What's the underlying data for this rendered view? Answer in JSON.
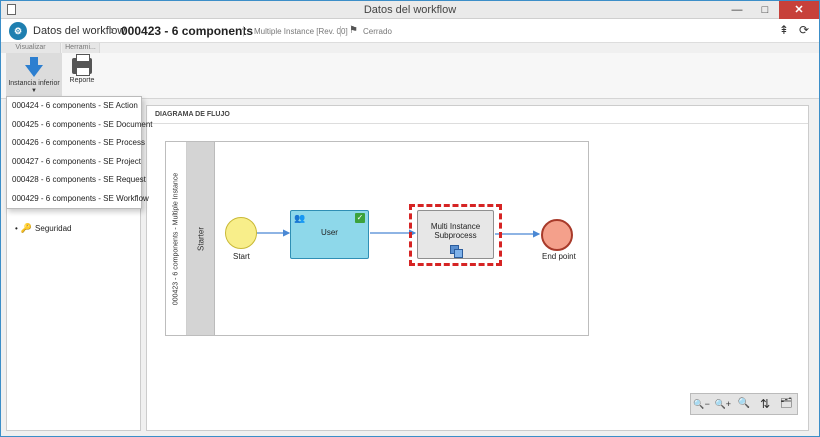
{
  "window": {
    "title": "Datos del workflow",
    "controls": [
      "—",
      "□",
      "✕"
    ]
  },
  "header": {
    "logo": "⚙",
    "title": "Datos del workflow",
    "separator": "›",
    "code": "000423 - 6 components",
    "pipe": "|",
    "instance_info": "Multiple Instance [Rev. 00]",
    "flag_icon": "⚑",
    "status": "Cerrado",
    "collapse_icon": "⇞",
    "refresh_icon": "⟳"
  },
  "ribbon": {
    "tabs": [
      "Visualizar",
      "Herrami..."
    ],
    "buttons": [
      {
        "label": "Instancia inferior",
        "caret": "▼"
      },
      {
        "label": "Reporte"
      }
    ]
  },
  "dropdown": {
    "items": [
      "000424 - 6 components - SE Action",
      "000425 - 6 components - SE Document",
      "000426 - 6 components - SE Process",
      "000427 - 6 components - SE Project",
      "000428 - 6 components - SE Request",
      "000429 - 6 components - SE Workflow"
    ]
  },
  "tree": {
    "bullet": "•",
    "key_icon": "🔑",
    "item": "Seguridad"
  },
  "diagram": {
    "section_title": "DIAGRAMA DE FLUJO",
    "pool_label": "000423 - 6 components - Multiple Instance",
    "lane_label": "Starter",
    "start_label": "Start",
    "user_task": "User",
    "user_icon": "👥",
    "check_icon": "✓",
    "subprocess_line1": "Multi Instance",
    "subprocess_line2": "Subprocess",
    "end_label": "End point"
  },
  "zoom_tools": {
    "icons": [
      "🔍−",
      "🔍+",
      "🔍",
      "⇅",
      "🗂"
    ]
  }
}
